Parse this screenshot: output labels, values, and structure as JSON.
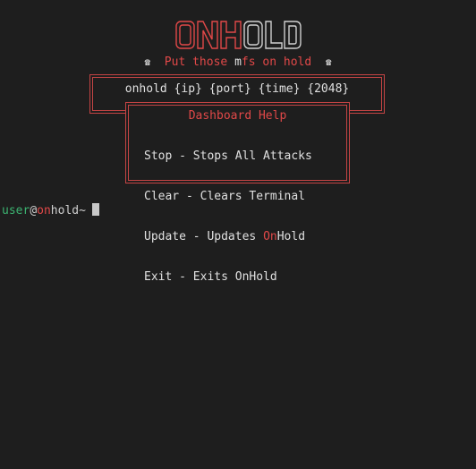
{
  "logo": {
    "text": "ONHOLD",
    "colors": {
      "on": "#e04848",
      "hold": "#d0d0d0"
    }
  },
  "tagline": {
    "icon_left": "telephone-icon",
    "icon_right": "telephone-icon",
    "phone_glyph": "☎",
    "part1": "Put those ",
    "part2": "m",
    "part3": "fs on hold"
  },
  "command": {
    "usage": "onhold {ip} {port} {time} {2048}"
  },
  "help": {
    "title": "Dashboard Help",
    "lines": [
      {
        "text": "Stop - Stops All Attacks"
      },
      {
        "text": "Clear - Clears Terminal"
      },
      {
        "prefix": "Update - Updates ",
        "highlight": "On",
        "suffix": "Hold"
      },
      {
        "text": "Exit - Exits OnHold"
      }
    ]
  },
  "prompt": {
    "user": "user",
    "at": "@",
    "host_red": "on",
    "host_rest": "hold",
    "tilde": "~"
  },
  "colors": {
    "background": "#1e1e1e",
    "accent": "#e04848",
    "text": "#e0e0e0",
    "user_green": "#3cb371"
  }
}
